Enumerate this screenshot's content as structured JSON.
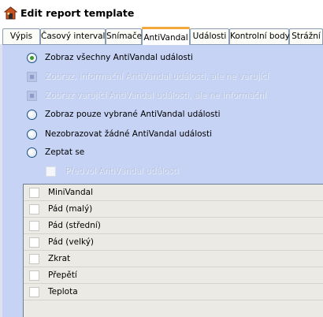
{
  "window": {
    "title": "Edit report template",
    "icon": "report-template-icon"
  },
  "tabs": [
    {
      "label": "Výpis",
      "active": false
    },
    {
      "label": "Časový interval",
      "active": false
    },
    {
      "label": "Snímače",
      "active": false
    },
    {
      "label": "AntiVandal",
      "active": true
    },
    {
      "label": "Události",
      "active": false
    },
    {
      "label": "Kontrolní body",
      "active": false
    },
    {
      "label": "Strážní",
      "active": false
    }
  ],
  "options": [
    {
      "label": "Zobraz všechny AntiVandal události",
      "selected": true,
      "enabled": true
    },
    {
      "label": "Zobraz, informační AntiVandal události, ale ne varující",
      "selected": false,
      "enabled": false
    },
    {
      "label": "Zobraz varující AntiVandal události, ale ne informační",
      "selected": false,
      "enabled": false
    },
    {
      "label": "Zobraz pouze vybrané AntiVandal události",
      "selected": false,
      "enabled": true
    },
    {
      "label": "Nezobrazovat žádné AntiVandal události",
      "selected": false,
      "enabled": true
    },
    {
      "label": "Zeptat se",
      "selected": false,
      "enabled": true
    }
  ],
  "preselect": {
    "label": "Předvol AntiVandal události",
    "checked": false,
    "enabled": false
  },
  "event_list": [
    {
      "label": "MiniVandal",
      "checked": false
    },
    {
      "label": "Pád (malý)",
      "checked": false
    },
    {
      "label": "Pád (střední)",
      "checked": false
    },
    {
      "label": "Pád (velký)",
      "checked": false
    },
    {
      "label": "Zkrat",
      "checked": false
    },
    {
      "label": "Přepětí",
      "checked": false
    },
    {
      "label": "Teplota",
      "checked": false
    }
  ],
  "colors": {
    "panel_bg": "#c6d3f5",
    "active_tab_accent": "#f3a93a",
    "radio_selected": "#3a9b2c",
    "list_bg": "#ebeae4"
  }
}
